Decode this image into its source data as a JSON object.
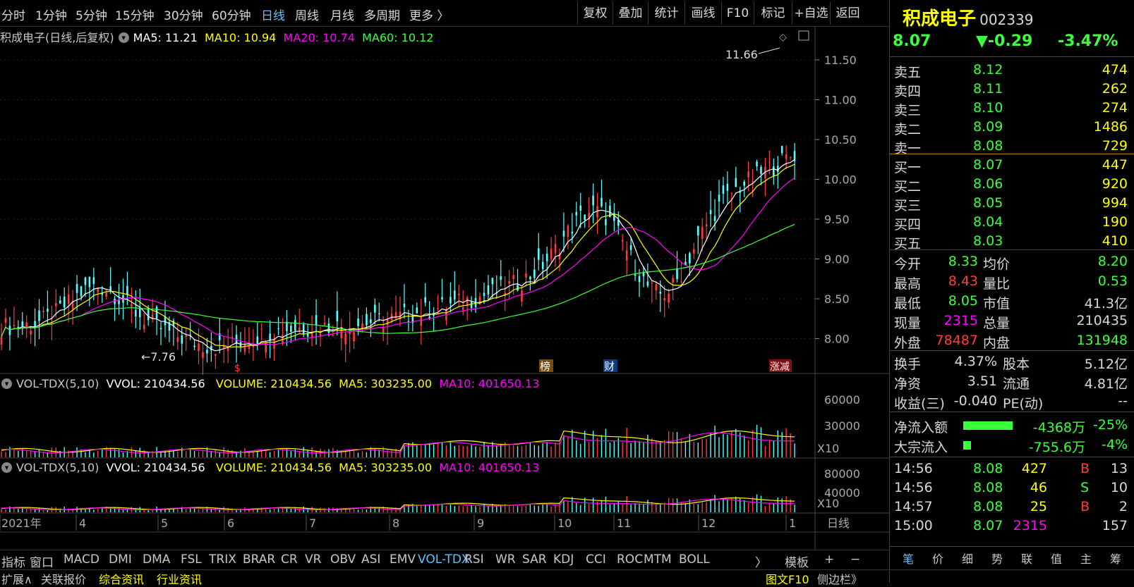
{
  "period_tabs": [
    "分时",
    "1分钟",
    "5分钟",
    "15分钟",
    "30分钟",
    "60分钟",
    "日线",
    "周线",
    "月线",
    "多周期",
    "更多 〉"
  ],
  "active_period": "日线",
  "toolbar_buttons": [
    "复权",
    "叠加",
    "统计",
    "画线",
    "F10",
    "标记",
    "+自选",
    "返回"
  ],
  "chart_info": {
    "title": "积成电子(日线,后复权)",
    "ma5": "MA5: 11.21",
    "ma10": "MA10: 10.94",
    "ma20": "MA20: 10.74",
    "ma60": "MA60: 10.12"
  },
  "vol_info": {
    "name": "VOL-TDX(5,10)",
    "vvol": "VVOL: 210434.56",
    "volume": "VOLUME: 210434.56",
    "ma5": "MA5: 303235.00",
    "ma10": "MA10: 401650.13"
  },
  "vol_info2": {
    "name": "VOL-TDX(5,10)",
    "vvol": "VVOL: 210434.56",
    "volume": "VOLUME: 210434.56",
    "ma5": "MA5: 303235.00",
    "ma10": "MA10: 401650.13"
  },
  "price_axis": [
    "11.50",
    "11.00",
    "10.50",
    "10.00",
    "9.50",
    "9.00",
    "8.50",
    "8.00"
  ],
  "vol_axis": [
    "60000",
    "30000"
  ],
  "vol_axis_unit": "X10",
  "vol_axis2": [
    "80000",
    "40000"
  ],
  "vol_axis2_unit": "X10",
  "annotations": {
    "high": "11.66",
    "low": "←7.76",
    "marker1": "$",
    "marker2": "榜",
    "marker3": "财",
    "marker4": "涨减"
  },
  "date_axis": [
    "2021年",
    "4",
    "5",
    "6",
    "7",
    "8",
    "9",
    "10",
    "11",
    "12",
    "1"
  ],
  "date_axis_label": "日线",
  "indicator_tabs": [
    "指标",
    "窗口",
    "MACD",
    "DMI",
    "DMA",
    "FSL",
    "TRIX",
    "BRAR",
    "CR",
    "VR",
    "OBV",
    "ASI",
    "EMV",
    "VOL-TDX",
    "RSI",
    "WR",
    "SAR",
    "KDJ",
    "CCI",
    "ROC",
    "MTM",
    "BOLL",
    "〉",
    "模板"
  ],
  "active_indicator": "VOL-TDX",
  "plus_minus": [
    "+",
    "−"
  ],
  "status_tabs": [
    "扩展∧",
    "关联报价",
    "综合资讯",
    "行业资讯"
  ],
  "status_right": [
    "图文F10",
    "侧边栏》"
  ],
  "stock": {
    "name": "积成电子",
    "code": "002339",
    "price": "8.07",
    "change": "▼-0.29",
    "change_pct": "-3.47%"
  },
  "asks": [
    {
      "label": "卖五",
      "price": "8.12",
      "vol": "474"
    },
    {
      "label": "卖四",
      "price": "8.11",
      "vol": "262"
    },
    {
      "label": "卖三",
      "price": "8.10",
      "vol": "274"
    },
    {
      "label": "卖二",
      "price": "8.09",
      "vol": "1486"
    },
    {
      "label": "卖一",
      "price": "8.08",
      "vol": "729"
    }
  ],
  "bids": [
    {
      "label": "买一",
      "price": "8.07",
      "vol": "447"
    },
    {
      "label": "买二",
      "price": "8.06",
      "vol": "920"
    },
    {
      "label": "买三",
      "price": "8.05",
      "vol": "994"
    },
    {
      "label": "买四",
      "price": "8.04",
      "vol": "190"
    },
    {
      "label": "买五",
      "price": "8.03",
      "vol": "410"
    }
  ],
  "stats": [
    {
      "l1": "今开",
      "v1": "8.33",
      "l2": "均价",
      "v2": "8.20"
    },
    {
      "l1": "最高",
      "v1": "8.43",
      "l2": "量比",
      "v2": "0.53"
    },
    {
      "l1": "最低",
      "v1": "8.05",
      "l2": "市值",
      "v2": "41.3亿"
    },
    {
      "l1": "现量",
      "v1": "2315",
      "l2": "总量",
      "v2": "210435"
    },
    {
      "l1": "外盘",
      "v1": "78487",
      "l2": "内盘",
      "v2": "131948"
    }
  ],
  "fund": [
    {
      "l1": "换手",
      "v1": "4.37%",
      "l2": "股本",
      "v2": "5.12亿"
    },
    {
      "l1": "净资",
      "v1": "3.51",
      "l2": "流通",
      "v2": "4.81亿"
    },
    {
      "l1": "收益(三)",
      "v1": "-0.040",
      "l2": "PE(动)",
      "v2": "--"
    }
  ],
  "flow": [
    {
      "label": "净流入额",
      "value": "-4368万",
      "pct": "-25%",
      "bar": 0.25
    },
    {
      "label": "大宗流入",
      "value": "-755.6万",
      "pct": "-4%",
      "bar": 0.04
    }
  ],
  "ticks": [
    {
      "time": "14:56",
      "price": "8.08",
      "vol": "427",
      "side": "B",
      "num": "13"
    },
    {
      "time": "14:56",
      "price": "8.08",
      "vol": "46",
      "side": "S",
      "num": "10"
    },
    {
      "time": "14:57",
      "price": "8.08",
      "vol": "25",
      "side": "B",
      "num": "2"
    },
    {
      "time": "15:00",
      "price": "8.07",
      "vol": "2315",
      "side": "",
      "num": "157"
    }
  ],
  "right_tabs": [
    "笔",
    "价",
    "细",
    "势",
    "联",
    "值",
    "主",
    "筹"
  ],
  "colors": {
    "up": "#ff3c3c",
    "down": "#54ffff",
    "green": "#3cff3c",
    "yellow": "#ffff00",
    "magenta": "#ff00ff",
    "white": "#ffffff",
    "accent": "#5bc4ff"
  }
}
